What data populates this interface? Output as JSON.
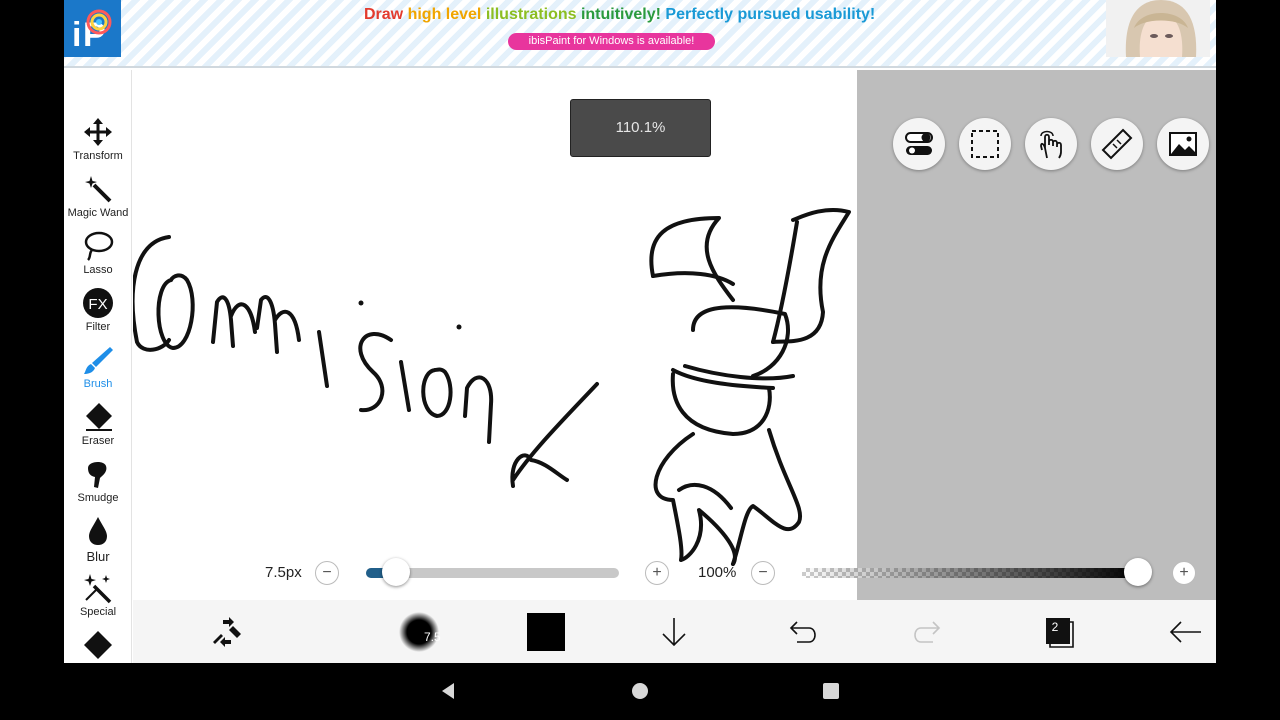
{
  "ad": {
    "headline_parts": [
      {
        "text": "Draw ",
        "color": "#e33b2e"
      },
      {
        "text": "high level ",
        "color": "#f0a500"
      },
      {
        "text": "illustrations ",
        "color": "#8cbe22"
      },
      {
        "text": "intuitively! ",
        "color": "#2a9a3e"
      },
      {
        "text": "Perfectly pursued usability!",
        "color": "#1a9ad6"
      }
    ],
    "subtext": "ibisPaint for Windows is available!"
  },
  "tools": [
    {
      "label": "Transform",
      "icon": "move-arrows-icon"
    },
    {
      "label": "Magic Wand",
      "icon": "magic-wand-icon"
    },
    {
      "label": "Lasso",
      "icon": "lasso-icon"
    },
    {
      "label": "Filter",
      "icon": "fx-icon",
      "icon_text": "FX"
    },
    {
      "label": "Brush",
      "icon": "brush-icon",
      "active": true
    },
    {
      "label": "Eraser",
      "icon": "eraser-icon"
    },
    {
      "label": "Smudge",
      "icon": "smudge-icon"
    },
    {
      "label": "Blur",
      "icon": "blur-drop-icon"
    },
    {
      "label": "Special",
      "icon": "special-sparkle-icon"
    },
    {
      "label": "",
      "icon": "fill-icon"
    }
  ],
  "canvas": {
    "zoom_label": "110.1%",
    "top_buttons": [
      "toggle-icon",
      "selection-icon",
      "hand-touch-icon",
      "ruler-icon",
      "image-icon"
    ]
  },
  "brush": {
    "size_label": "7.5px",
    "size_fraction": 0.12,
    "opacity_label": "100%",
    "opacity_fraction": 1.0,
    "minus": "−",
    "plus": "+"
  },
  "bottom_bar": {
    "brush_preview_label": "7.5",
    "color_swatch": "#000000",
    "layer_count": "2"
  }
}
